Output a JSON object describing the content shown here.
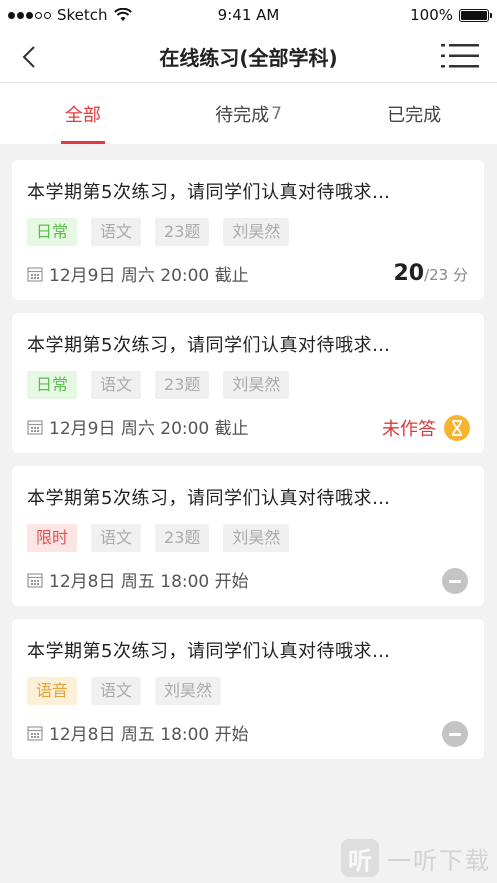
{
  "status_bar": {
    "carrier": "Sketch",
    "time": "9:41 AM",
    "battery": "100%"
  },
  "header": {
    "title": "在线练习(全部学科)"
  },
  "tabs": [
    {
      "label": "全部",
      "count": ""
    },
    {
      "label": "待完成",
      "count": "7"
    },
    {
      "label": "已完成",
      "count": ""
    }
  ],
  "cards": [
    {
      "title": "本学期第5次练习，请同学们认真对待哦求…",
      "tags": [
        "日常",
        "语文",
        "23题",
        "刘昊然"
      ],
      "date": "12月9日 周六 20:00 截止",
      "score": "20",
      "score_total": "/23 分"
    },
    {
      "title": "本学期第5次练习，请同学们认真对待哦求…",
      "tags": [
        "日常",
        "语文",
        "23题",
        "刘昊然"
      ],
      "date": "12月9日 周六 20:00 截止",
      "status": "未作答"
    },
    {
      "title": "本学期第5次练习，请同学们认真对待哦求…",
      "tags": [
        "限时",
        "语文",
        "23题",
        "刘昊然"
      ],
      "date": "12月8日 周五 18:00 开始"
    },
    {
      "title": "本学期第5次练习，请同学们认真对待哦求…",
      "tags": [
        "语音",
        "语文",
        "刘昊然"
      ],
      "date": "12月8日 周五 18:00 开始"
    }
  ],
  "watermark": {
    "logo": "听",
    "text": "一听下载"
  },
  "colors": {
    "accent": "#e13b3b",
    "daily": "#5bbd4f",
    "timed": "#e05353",
    "voice": "#e6a23c",
    "hourglass": "#f5b52e"
  }
}
